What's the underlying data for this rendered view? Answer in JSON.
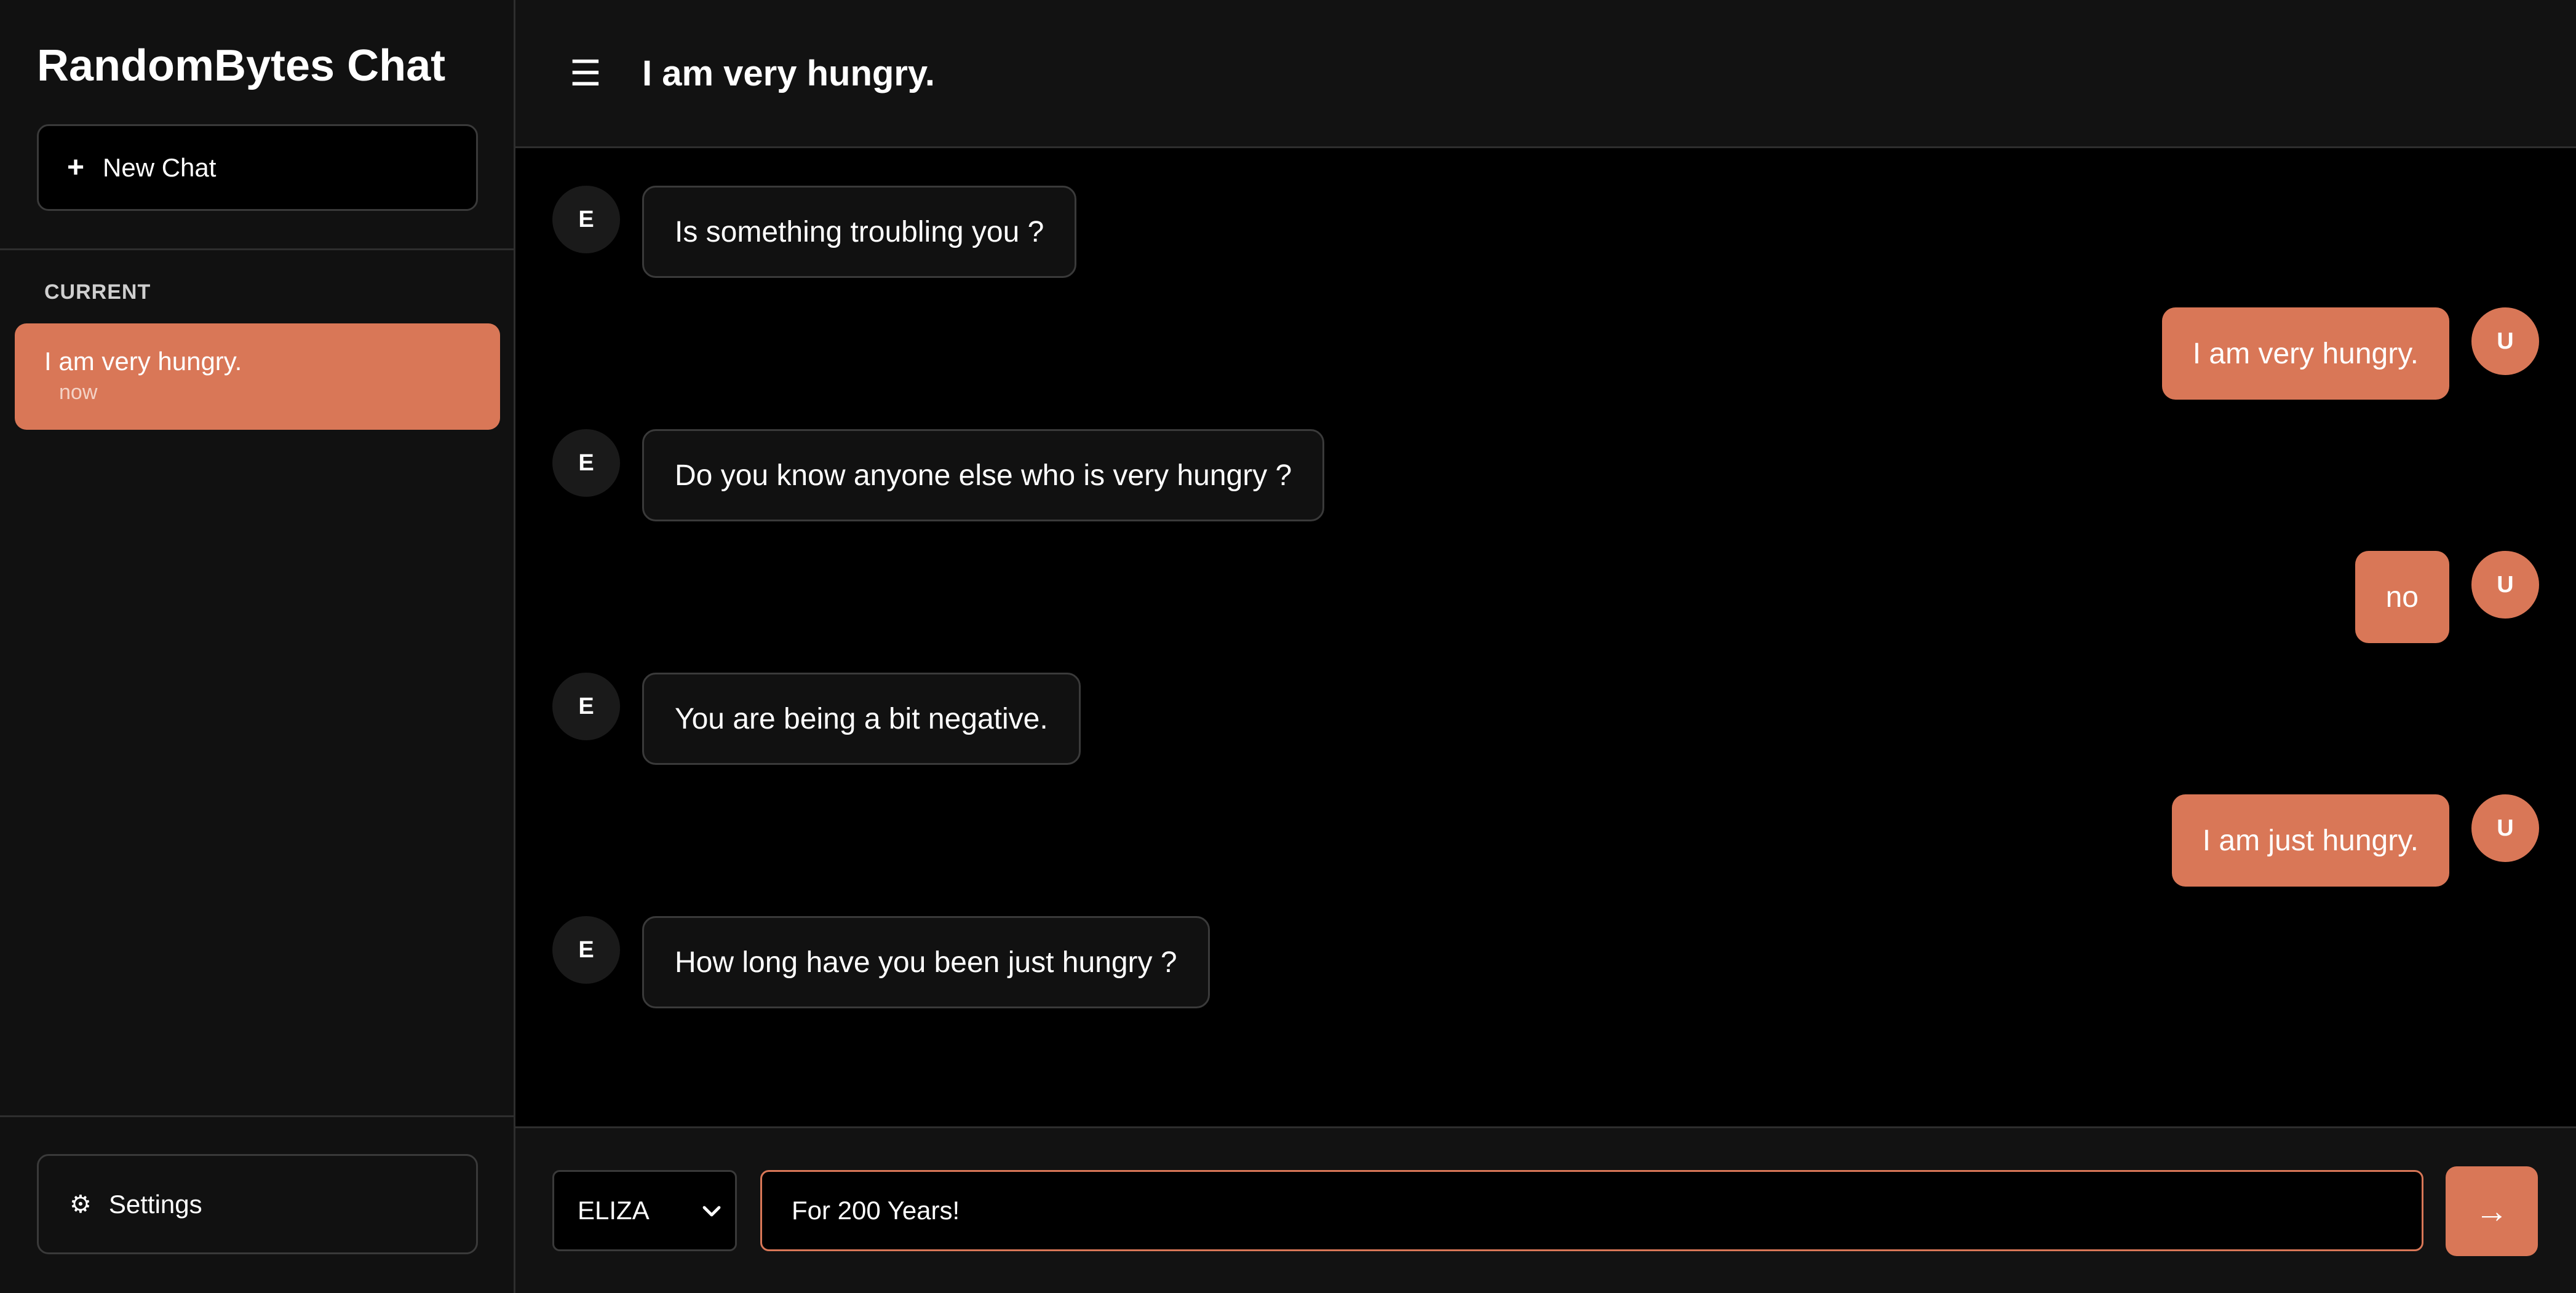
{
  "sidebar": {
    "brand": "RandomBytes Chat",
    "new_chat_label": "New Chat",
    "new_chat_icon": "+",
    "section_label": "CURRENT",
    "chats": [
      {
        "title": "I am very hungry.",
        "time": "now"
      }
    ],
    "settings_label": "Settings",
    "settings_icon": "⚙"
  },
  "header": {
    "menu_icon": "☰",
    "title": "I am very hungry."
  },
  "messages": [
    {
      "role": "bot",
      "avatar": "E",
      "text": "Is something troubling you ?"
    },
    {
      "role": "user",
      "avatar": "U",
      "text": "I am very hungry."
    },
    {
      "role": "bot",
      "avatar": "E",
      "text": "Do you know anyone else who is very hungry ?"
    },
    {
      "role": "user",
      "avatar": "U",
      "text": "no"
    },
    {
      "role": "bot",
      "avatar": "E",
      "text": "You are being a bit negative."
    },
    {
      "role": "user",
      "avatar": "U",
      "text": "I am just hungry."
    },
    {
      "role": "bot",
      "avatar": "E",
      "text": "How long have you been just hungry ?"
    }
  ],
  "composer": {
    "model": "ELIZA",
    "input_value": "For 200 Years!",
    "send_icon": "→"
  },
  "colors": {
    "accent": "#d97757",
    "sidebar_bg": "#111111",
    "main_bg": "#000000"
  }
}
